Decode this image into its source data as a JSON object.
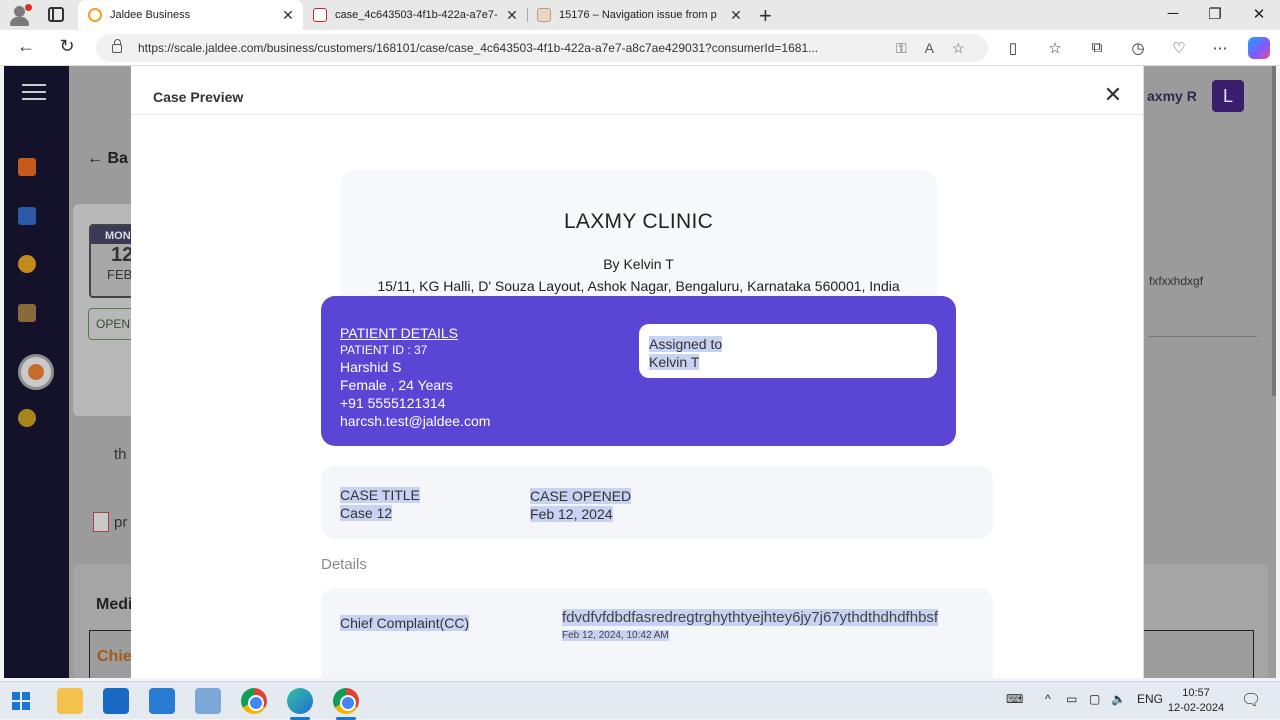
{
  "browser": {
    "tabs": [
      {
        "title": "Jaldee Business",
        "active": true
      },
      {
        "title": "case_4c643503-4f1b-422a-a7e7-",
        "active": false
      },
      {
        "title": "15176 – Navigation issue from p",
        "active": false
      }
    ],
    "url": "https://scale.jaldee.com/business/customers/168101/case/case_4c643503-4f1b-422a-a7e7-a8c7ae429031?consumerId=1681..."
  },
  "background_page": {
    "back_label": "Ba",
    "calendar_day": "MON",
    "calendar_date": "12",
    "calendar_month": "FEB",
    "open_label": "OPEN",
    "th_text": "th",
    "pr_text": "pr",
    "medi_text": "Medi",
    "chie_text": "Chie",
    "user_name": "axmy R",
    "user_initial": "L",
    "fx_text": "fxfxxhdxgf"
  },
  "modal": {
    "title": "Case Preview",
    "clinic": {
      "name": "LAXMY CLINIC",
      "by": "By Kelvin T",
      "address": "15/11, KG Halli, D' Souza Layout, Ashok Nagar, Bengaluru, Karnataka 560001, India"
    },
    "patient": {
      "heading": "PATIENT DETAILS",
      "id_line": "PATIENT ID : 37",
      "name": "Harshid S",
      "gender_age": "Female , 24 Years",
      "phone": "+91 5555121314",
      "email": "harcsh.test@jaldee.com",
      "assigned_label": "Assigned to",
      "assigned_value": "Kelvin T"
    },
    "case": {
      "title_label": "CASE TITLE",
      "title_value": "Case 12",
      "opened_label": "CASE OPENED",
      "opened_value": "Feb 12, 2024"
    },
    "details_label": "Details",
    "chief_complaint": {
      "label": "Chief Complaint(CC)",
      "text": "fdvdfvfdbdfasredregtrghythtyejhtey6jy7j67ythdthdhdfhbsf",
      "timestamp": "Feb 12, 2024, 10:42 AM"
    }
  },
  "taskbar": {
    "lang": "ENG",
    "time": "10:57",
    "date": "12-02-2024"
  },
  "colors": {
    "patient_card": "#5b45d4",
    "sidebar": "#14122a",
    "selection": "#c8d3f3"
  }
}
